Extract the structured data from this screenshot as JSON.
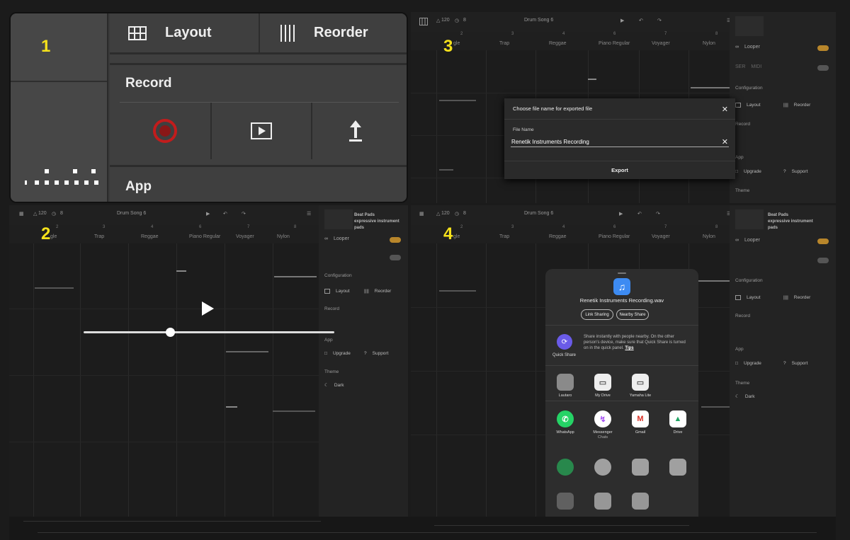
{
  "steps": [
    "1",
    "2",
    "3",
    "4"
  ],
  "zoom": {
    "layout_label": "Layout",
    "reorder_label": "Reorder",
    "record_label": "Record",
    "app_label": "App"
  },
  "app": {
    "bpm": "120",
    "timer": "8",
    "song": "Drum Song 6",
    "ruler": [
      "1",
      "2",
      "3",
      "4",
      "5",
      "6",
      "7",
      "8"
    ],
    "presets": [
      "gle",
      "Trap",
      "Reggae",
      "Piano Regular",
      "Voyager",
      "Nylon"
    ],
    "panel": {
      "name_line1": "Beat Pads",
      "name_line2": "expressive instrument",
      "name_line3": "pads",
      "looper": "Looper",
      "midi_a": "SER",
      "midi_b": "MIDI",
      "configuration": "Configuration",
      "layout": "Layout",
      "reorder": "Reorder",
      "record": "Record",
      "app": "App",
      "upgrade": "Upgrade",
      "support": "Support",
      "theme": "Theme",
      "dark": "Dark"
    }
  },
  "dialog": {
    "title": "Choose file name for exported file",
    "field_label": "File Name",
    "file_name": "Renetik Instruments Recording",
    "export_label": "Export"
  },
  "share": {
    "file_name": "Renetik Instruments Recording.wav",
    "link_sharing": "Link Sharing",
    "nearby_share": "Nearby Share",
    "quick_share_label": "Quick Share",
    "quick_share_text": "Share instantly with people nearby. On the other person's device, make sure that Quick Share is turned on in the quick panel.",
    "quick_share_tips": "Tips",
    "contacts": [
      {
        "label": "Lautaro",
        "icon": "contact-whatsapp-icon",
        "color": "#8a8a8a"
      },
      {
        "label": "My Drive",
        "icon": "folder-drive-icon",
        "color": "#f2f2f2"
      },
      {
        "label": "Yamaha Lite",
        "icon": "folder-drive-icon",
        "color": "#f2f2f2"
      }
    ],
    "apps": [
      {
        "label": "WhatsApp",
        "icon": "whatsapp-icon",
        "color": "#25d366"
      },
      {
        "label": "Messenger",
        "sub": "Chats",
        "icon": "messenger-icon",
        "color": "#ffffff"
      },
      {
        "label": "Gmail",
        "icon": "gmail-icon",
        "color": "#ffffff"
      },
      {
        "label": "Drive",
        "icon": "drive-icon",
        "color": "#ffffff"
      }
    ]
  }
}
